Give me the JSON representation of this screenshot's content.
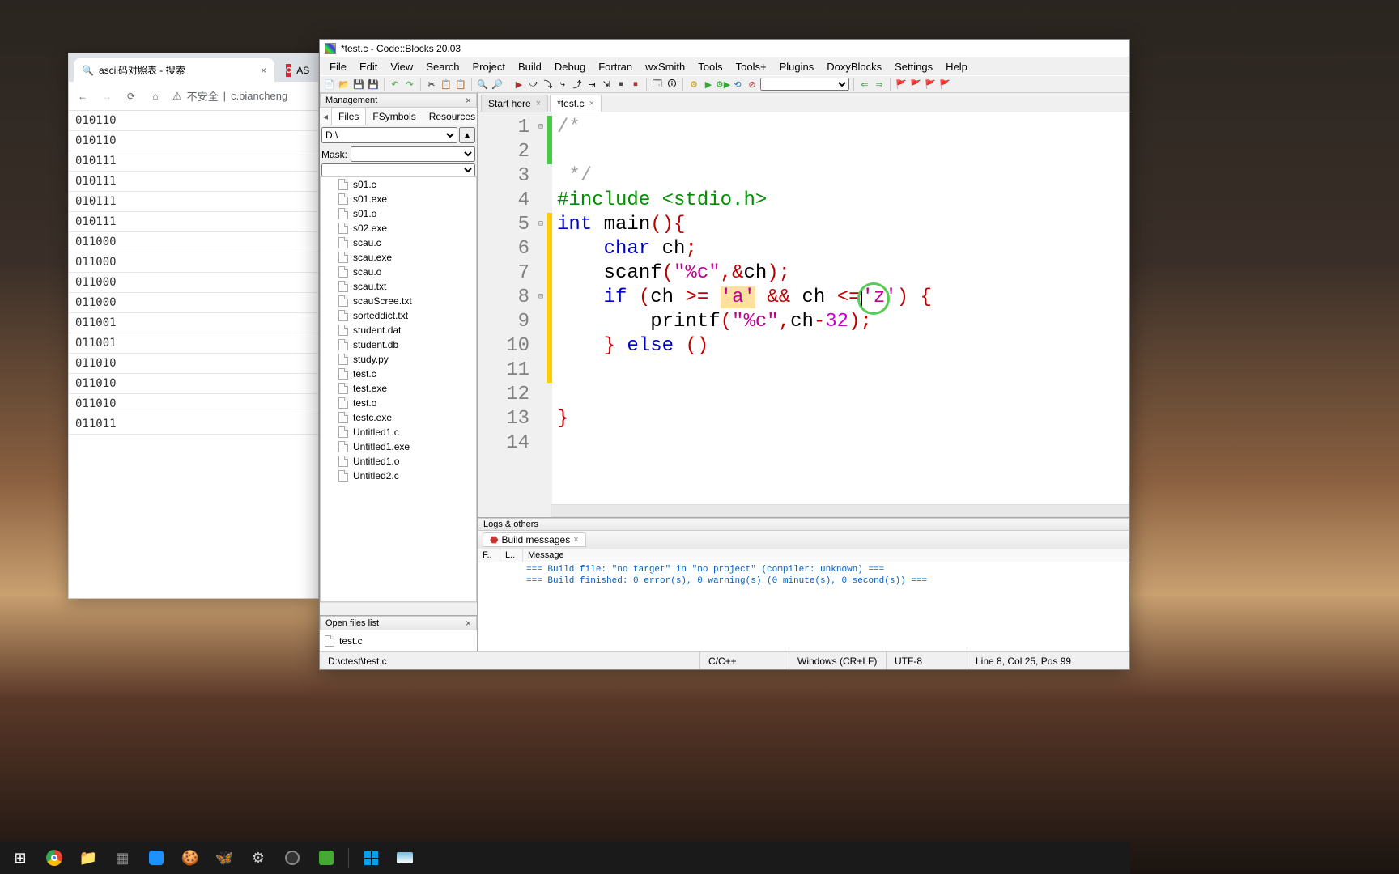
{
  "chrome": {
    "tabs": [
      {
        "icon": "🔍",
        "title": "ascii码对照表 - 搜索"
      },
      {
        "icon": "C",
        "title": "ASC"
      }
    ],
    "url_warning": "不安全",
    "url": "c.biancheng",
    "ascii_rows": [
      "010110",
      "010110",
      "010111",
      "010111",
      "010111",
      "010111",
      "011000",
      "011000",
      "011000",
      "011000",
      "011001",
      "011001",
      "011010",
      "011010",
      "011010",
      "011011"
    ]
  },
  "cb": {
    "title": "*test.c - Code::Blocks 20.03",
    "menu": [
      "File",
      "Edit",
      "View",
      "Search",
      "Project",
      "Build",
      "Debug",
      "Fortran",
      "wxSmith",
      "Tools",
      "Tools+",
      "Plugins",
      "DoxyBlocks",
      "Settings",
      "Help"
    ],
    "mgmt": {
      "title": "Management",
      "tabs": [
        "Files",
        "FSymbols",
        "Resources"
      ],
      "active_tab": 0,
      "path": "D:\\",
      "mask_label": "Mask:",
      "mask_value": "",
      "files": [
        "s01.c",
        "s01.exe",
        "s01.o",
        "s02.exe",
        "scau.c",
        "scau.exe",
        "scau.o",
        "scau.txt",
        "scauScree.txt",
        "sorteddict.txt",
        "student.dat",
        "student.db",
        "study.py",
        "test.c",
        "test.exe",
        "test.o",
        "testc.exe",
        "Untitled1.c",
        "Untitled1.exe",
        "Untitled1.o",
        "Untitled2.c"
      ]
    },
    "open_files": {
      "title": "Open files list",
      "items": [
        "test.c"
      ]
    },
    "editor_tabs": [
      {
        "label": "Start here",
        "active": false
      },
      {
        "label": "*test.c",
        "active": true
      }
    ],
    "code": {
      "lines": 14,
      "l1": "/*",
      "l3": " */",
      "l4a": "#include ",
      "l4b": "<stdio.h>",
      "l5a": "int",
      "l5b": " main",
      "l5c": "()",
      "l5d": "{",
      "l6a": "    char",
      "l6b": " ch",
      "l6c": ";",
      "l7a": "    scanf",
      "l7b": "(",
      "l7c": "\"%c\"",
      "l7d": ",",
      "l7e": "&",
      "l7f": "ch",
      "l7g": ")",
      "l7h": ";",
      "l8a": "    if ",
      "l8b": "(",
      "l8c": "ch ",
      "l8d": ">= ",
      "l8e": "'a'",
      "l8f": " && ",
      "l8g": "ch ",
      "l8h": "<=",
      "l8i": "'z'",
      "l8j": ")",
      "l8k": " {",
      "l9a": "        printf",
      "l9b": "(",
      "l9c": "\"%c\"",
      "l9d": ",",
      "l9e": "ch",
      "l9f": "-",
      "l9g": "32",
      "l9h": ")",
      "l9i": ";",
      "l10a": "    }",
      "l10b": " else ",
      "l10c": "()",
      "l13": "}"
    },
    "logs": {
      "title": "Logs & others",
      "tab": "Build messages",
      "cols": [
        "F..",
        "L..",
        "Message"
      ],
      "line1": "=== Build file: \"no target\" in \"no project\" (compiler: unknown) ===",
      "line2": "=== Build finished: 0 error(s), 0 warning(s) (0 minute(s), 0 second(s)) ==="
    },
    "status": {
      "path": "D:\\ctest\\test.c",
      "lang": "C/C++",
      "eol": "Windows (CR+LF)",
      "enc": "UTF-8",
      "pos": "Line 8, Col 25, Pos 99"
    }
  }
}
